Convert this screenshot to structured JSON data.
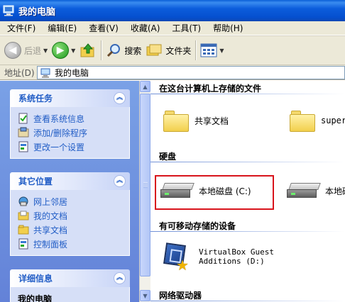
{
  "window": {
    "title": "我的电脑"
  },
  "menu": [
    "文件(F)",
    "编辑(E)",
    "查看(V)",
    "收藏(A)",
    "工具(T)",
    "帮助(H)"
  ],
  "toolbar": {
    "back": "后退",
    "search": "搜索",
    "folders": "文件夹"
  },
  "address": {
    "label": "地址(D)",
    "value": "我的电脑"
  },
  "left_pane": {
    "system_tasks": {
      "title": "系统任务",
      "items": [
        "查看系统信息",
        "添加/删除程序",
        "更改一个设置"
      ]
    },
    "other_places": {
      "title": "其它位置",
      "items": [
        "网上邻居",
        "我的文档",
        "共享文档",
        "控制面板"
      ]
    },
    "details": {
      "title": "详细信息",
      "first": "我的电脑"
    }
  },
  "right_pane": {
    "section_files": "在这台计算机上存储的文件",
    "shared_docs": "共享文档",
    "super_docs": "super",
    "section_disks": "硬盘",
    "local_c": "本地磁盘 (C:)",
    "local_other": "本地磁",
    "section_removable": "有可移动存储的设备",
    "vbox_line1": "VirtualBox Guest",
    "vbox_line2": "Additions (D:)",
    "section_network": "网络驱动器"
  },
  "colors": {
    "accent": "#215dc6",
    "highlight_border": "#d8141c",
    "title_bar": "#0550d0"
  }
}
